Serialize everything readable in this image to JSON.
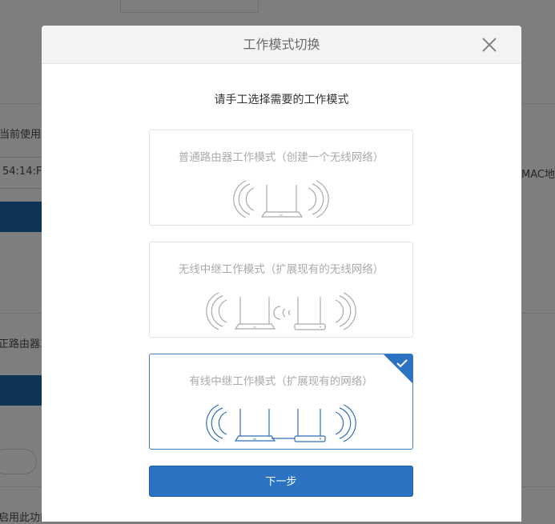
{
  "background": {
    "text_current_use": "当前使用的",
    "text_mac_value": "54:14:F",
    "text_mac_label": "MAC地址",
    "text_router": "正路由器工",
    "text_enable": "启用此功能"
  },
  "dialog": {
    "title": "工作模式切换",
    "prompt": "请手工选择需要的工作模式",
    "modes": [
      {
        "label": "普通路由器工作模式（创建一个无线网络）",
        "selected": false
      },
      {
        "label": "无线中继工作模式（扩展现有的无线网络）",
        "selected": false
      },
      {
        "label": "有线中继工作模式（扩展现有的网络）",
        "selected": true
      }
    ],
    "router_brand": "mi",
    "next_button": "下一步"
  },
  "colors": {
    "accent": "#2b72c3",
    "selected_border": "#3b7fc9",
    "illustration_inactive": "#a9a9a9",
    "illustration_active": "#2f6fb8",
    "overlay": "#7e7e7e"
  },
  "icons": {
    "close": "close-icon",
    "selected": "check-icon",
    "router": "router-icon",
    "repeater": "repeater-icon",
    "wifi_waves": "wifi-waves-icon"
  }
}
